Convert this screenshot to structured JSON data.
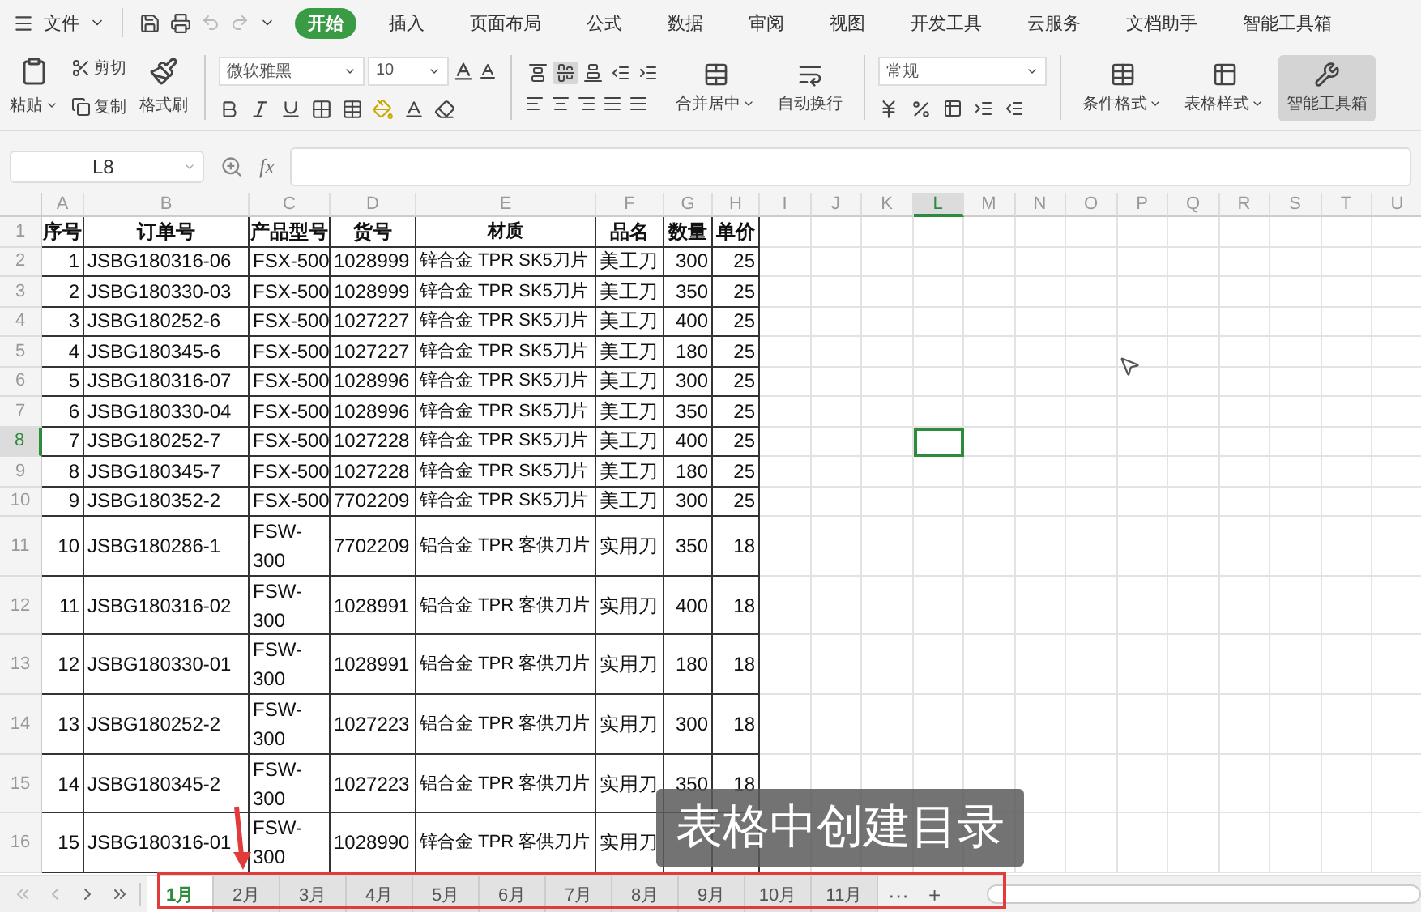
{
  "menu": {
    "file": "文件",
    "tabs": [
      {
        "label": "开始",
        "selected": true
      },
      {
        "label": "插入",
        "selected": false
      },
      {
        "label": "页面布局",
        "selected": false
      },
      {
        "label": "公式",
        "selected": false
      },
      {
        "label": "数据",
        "selected": false
      },
      {
        "label": "审阅",
        "selected": false
      },
      {
        "label": "视图",
        "selected": false
      },
      {
        "label": "开发工具",
        "selected": false
      },
      {
        "label": "云服务",
        "selected": false
      },
      {
        "label": "文档助手",
        "selected": false
      },
      {
        "label": "智能工具箱",
        "selected": false
      }
    ]
  },
  "ribbon": {
    "paste": "粘贴",
    "cut": "剪切",
    "copy": "复制",
    "format_painter": "格式刷",
    "font_name": "微软雅黑",
    "font_size": "10",
    "align_top": [
      {
        "pressed": false
      },
      {
        "pressed": true
      },
      {
        "pressed": false
      },
      {
        "pressed": false
      },
      {
        "pressed": false
      }
    ],
    "merge": "合并居中",
    "wrap": "自动换行",
    "number_format": "常规",
    "conditional_format": "条件格式",
    "table_style": "表格样式",
    "toolbox": {
      "label": "智能工具箱",
      "pressed": true
    }
  },
  "formula_bar": {
    "cell_ref": "L8",
    "fx": "fx"
  },
  "sheet": {
    "columns": [
      {
        "label": "A",
        "selected": false
      },
      {
        "label": "B",
        "selected": false
      },
      {
        "label": "C",
        "selected": false
      },
      {
        "label": "D",
        "selected": false
      },
      {
        "label": "E",
        "selected": false
      },
      {
        "label": "F",
        "selected": false
      },
      {
        "label": "G",
        "selected": false
      },
      {
        "label": "H",
        "selected": false
      },
      {
        "label": "I",
        "selected": false
      },
      {
        "label": "J",
        "selected": false
      },
      {
        "label": "K",
        "selected": false
      },
      {
        "label": "L",
        "selected": true
      },
      {
        "label": "M",
        "selected": false
      },
      {
        "label": "N",
        "selected": false
      },
      {
        "label": "O",
        "selected": false
      },
      {
        "label": "P",
        "selected": false
      },
      {
        "label": "Q",
        "selected": false
      },
      {
        "label": "R",
        "selected": false
      },
      {
        "label": "S",
        "selected": false
      },
      {
        "label": "T",
        "selected": false
      },
      {
        "label": "U",
        "selected": false
      }
    ],
    "rows": [
      {
        "number": "1",
        "selected": false,
        "kind": "header",
        "cells": [
          "序号",
          "订单号",
          "产品型号",
          "货号",
          "材质",
          "品名",
          "数量",
          "单价"
        ]
      },
      {
        "number": "2",
        "selected": false,
        "kind": "short",
        "cells": [
          "1",
          "JSBG180316-06",
          "FSX-500",
          "1028999",
          "锌合金  TPR SK5刀片",
          "美工刀",
          "300",
          "25"
        ]
      },
      {
        "number": "3",
        "selected": false,
        "kind": "short",
        "cells": [
          "2",
          "JSBG180330-03",
          "FSX-500",
          "1028999",
          "锌合金  TPR SK5刀片",
          "美工刀",
          "350",
          "25"
        ]
      },
      {
        "number": "4",
        "selected": false,
        "kind": "short",
        "cells": [
          "3",
          "JSBG180252-6",
          "FSX-500",
          "1027227",
          "锌合金  TPR SK5刀片",
          "美工刀",
          "400",
          "25"
        ]
      },
      {
        "number": "5",
        "selected": false,
        "kind": "short",
        "cells": [
          "4",
          "JSBG180345-6",
          "FSX-500",
          "1027227",
          "锌合金  TPR SK5刀片",
          "美工刀",
          "180",
          "25"
        ]
      },
      {
        "number": "6",
        "selected": false,
        "kind": "short",
        "cells": [
          "5",
          "JSBG180316-07",
          "FSX-500",
          "1028996",
          "锌合金  TPR SK5刀片",
          "美工刀",
          "300",
          "25"
        ]
      },
      {
        "number": "7",
        "selected": false,
        "kind": "short",
        "cells": [
          "6",
          "JSBG180330-04",
          "FSX-500",
          "1028996",
          "锌合金  TPR SK5刀片",
          "美工刀",
          "350",
          "25"
        ]
      },
      {
        "number": "8",
        "selected": true,
        "kind": "short",
        "cells": [
          "7",
          "JSBG180252-7",
          "FSX-500",
          "1027228",
          "锌合金  TPR SK5刀片",
          "美工刀",
          "400",
          "25"
        ]
      },
      {
        "number": "9",
        "selected": false,
        "kind": "short",
        "cells": [
          "8",
          "JSBG180345-7",
          "FSX-500",
          "1027228",
          "锌合金  TPR SK5刀片",
          "美工刀",
          "180",
          "25"
        ]
      },
      {
        "number": "10",
        "selected": false,
        "kind": "short",
        "cells": [
          "9",
          "JSBG180352-2",
          "FSX-500",
          "7702209",
          "锌合金  TPR SK5刀片",
          "美工刀",
          "300",
          "25"
        ]
      },
      {
        "number": "11",
        "selected": false,
        "kind": "tall",
        "cells": [
          "10",
          "JSBG180286-1",
          "FSW-300",
          "7702209",
          "铝合金  TPR 客供刀片",
          "实用刀",
          "350",
          "18"
        ]
      },
      {
        "number": "12",
        "selected": false,
        "kind": "tall",
        "cells": [
          "11",
          "JSBG180316-02",
          "FSW-300",
          "1028991",
          "铝合金  TPR 客供刀片",
          "实用刀",
          "400",
          "18"
        ]
      },
      {
        "number": "13",
        "selected": false,
        "kind": "tall",
        "cells": [
          "12",
          "JSBG180330-01",
          "FSW-300",
          "1028991",
          "铝合金  TPR 客供刀片",
          "实用刀",
          "180",
          "18"
        ]
      },
      {
        "number": "14",
        "selected": false,
        "kind": "tall",
        "cells": [
          "13",
          "JSBG180252-2",
          "FSW-300",
          "1027223",
          "铝合金  TPR 客供刀片",
          "实用刀",
          "300",
          "18"
        ]
      },
      {
        "number": "15",
        "selected": false,
        "kind": "tall",
        "cells": [
          "14",
          "JSBG180345-2",
          "FSW-300",
          "1027223",
          "铝合金  TPR 客供刀片",
          "实用刀",
          "350",
          "18"
        ]
      },
      {
        "number": "16",
        "selected": false,
        "kind": "tall",
        "cells": [
          "15",
          "JSBG180316-01",
          "FSW-300",
          "1028990",
          "锌合金  TPR 客供刀片",
          "实用刀",
          "",
          ""
        ]
      }
    ]
  },
  "sheet_tabs": [
    {
      "label": "1月",
      "selected": true
    },
    {
      "label": "2月",
      "selected": false
    },
    {
      "label": "3月",
      "selected": false
    },
    {
      "label": "4月",
      "selected": false
    },
    {
      "label": "5月",
      "selected": false
    },
    {
      "label": "6月",
      "selected": false
    },
    {
      "label": "7月",
      "selected": false
    },
    {
      "label": "8月",
      "selected": false
    },
    {
      "label": "9月",
      "selected": false
    },
    {
      "label": "10月",
      "selected": false
    },
    {
      "label": "11月",
      "selected": false
    }
  ],
  "more_tabs": "···",
  "add_tab": "+",
  "caption": "表格中创建目录"
}
